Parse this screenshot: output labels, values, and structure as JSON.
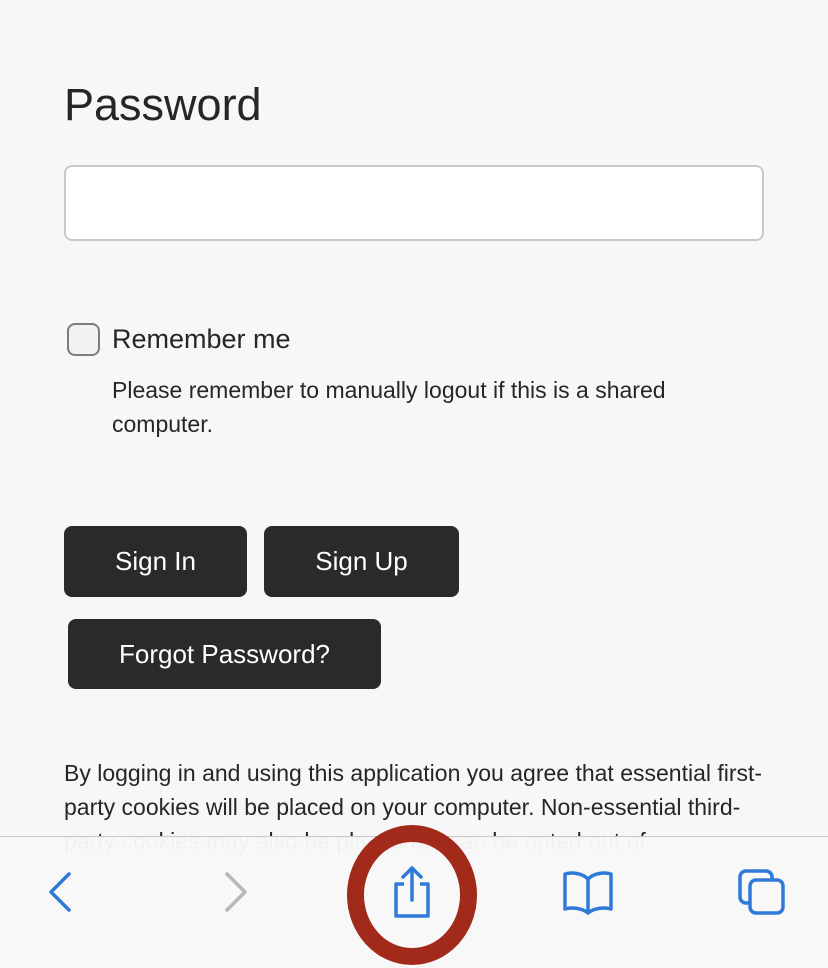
{
  "form": {
    "password_label": "Password",
    "password_value": "",
    "remember_label": "Remember me",
    "remember_checked": false,
    "remember_note": "Please remember to manually logout if this is a shared computer."
  },
  "buttons": {
    "sign_in": "Sign In",
    "sign_up": "Sign Up",
    "forgot_password": "Forgot Password?"
  },
  "consent_text": "By logging in and using this application you agree that essential first-party cookies will be placed on your computer. Non-essential third-party cookies may also be placed but can be opted out of",
  "toolbar": {
    "icons": [
      "back-icon",
      "forward-icon",
      "share-icon",
      "bookmarks-icon",
      "tabs-icon"
    ],
    "accent_color": "#2f7ad8",
    "disabled_color": "#b7b7b7",
    "highlight_color": "#a22a1a"
  }
}
